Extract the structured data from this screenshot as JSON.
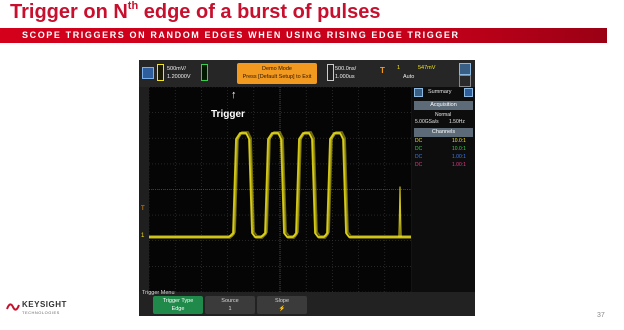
{
  "slide": {
    "title_pre": "Trigger on N",
    "title_sup": "th",
    "title_post": " edge of a burst of pulses",
    "banner": "SCOPE TRIGGERS ON RANDOM EDGES WHEN USING RISING EDGE TRIGGER",
    "page_number": "37",
    "logo_name": "KEYSIGHT",
    "logo_sub": "TECHNOLOGIES"
  },
  "scope": {
    "channel_scale": "500mV/",
    "channel_offset": "1.20000V",
    "demo_line1": "Demo Mode",
    "demo_line2": "Press [Default Setup] to Exit",
    "time_scale": "500.0ns/",
    "time_delay": "1.000us",
    "trig_label": "T",
    "trig_channel": "1",
    "trig_level": "547mV",
    "trig_mode": "Auto",
    "trigger_annotation": "Trigger",
    "ground_marker": "1",
    "trigger_level_marker": "T",
    "sidebar": {
      "tab_label": "Summary",
      "acquisition_header": "Acquisition",
      "acq_mode": "Normal",
      "sample_rate": "5.00GSa/s",
      "acq_freq": "1.50Hz",
      "channels_header": "Channels",
      "channels": [
        {
          "coupling": "DC",
          "ratio": "10.0:1",
          "color": "#f2e51c"
        },
        {
          "coupling": "DC",
          "ratio": "10.0:1",
          "color": "#33d24a"
        },
        {
          "coupling": "DC",
          "ratio": "1.00:1",
          "color": "#3f7cf0"
        },
        {
          "coupling": "DC",
          "ratio": "1.00:1",
          "color": "#e83a8a"
        }
      ]
    },
    "softkeys": {
      "menu_title": "Trigger Menu",
      "trigger_type_label": "Trigger Type",
      "trigger_type_value": "Edge",
      "source_label": "Source",
      "source_value": "1",
      "slope_label": "Slope",
      "slope_value": "⚡"
    },
    "waveform_color": "#f2e51c"
  }
}
